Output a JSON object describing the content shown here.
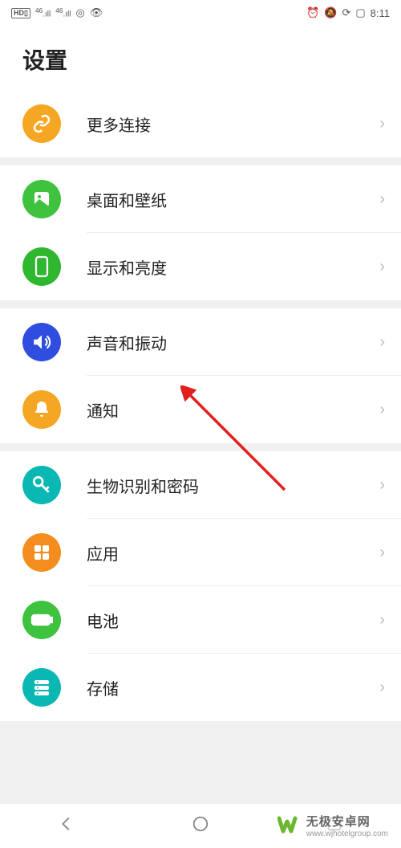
{
  "status": {
    "left_indicators": [
      "HD",
      "46",
      "46"
    ],
    "time": "8:11"
  },
  "title": "设置",
  "sections": [
    {
      "items": [
        {
          "key": "more_connections",
          "label": "更多连接",
          "icon": "link-icon",
          "color": "#f5a623"
        }
      ]
    },
    {
      "items": [
        {
          "key": "wallpaper",
          "label": "桌面和壁纸",
          "icon": "image-icon",
          "color": "#3fc33f"
        },
        {
          "key": "display",
          "label": "显示和亮度",
          "icon": "phone-icon",
          "color": "#2fb82f"
        }
      ]
    },
    {
      "items": [
        {
          "key": "sound",
          "label": "声音和振动",
          "icon": "sound-icon",
          "color": "#2f4ee0"
        },
        {
          "key": "notification",
          "label": "通知",
          "icon": "bell-icon",
          "color": "#f5a623"
        }
      ]
    },
    {
      "items": [
        {
          "key": "biometrics",
          "label": "生物识别和密码",
          "icon": "key-icon",
          "color": "#0ab8b3"
        },
        {
          "key": "apps",
          "label": "应用",
          "icon": "grid-icon",
          "color": "#f58d1e"
        },
        {
          "key": "battery",
          "label": "电池",
          "icon": "battery-icon",
          "color": "#3fc33f"
        },
        {
          "key": "storage",
          "label": "存储",
          "icon": "storage-icon",
          "color": "#0ab8b3"
        }
      ]
    }
  ],
  "watermark": {
    "brand": "无极安卓网",
    "url": "www.wjhotelgroup.com"
  }
}
